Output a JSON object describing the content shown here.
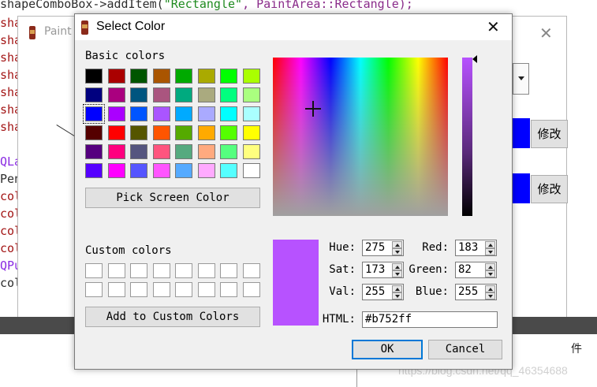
{
  "editor": {
    "top_line_prefix": "shapeComboBox->addItem(",
    "top_line_string": "\"Rectangle\"",
    "top_line_suffix": ", PaintArea::Rectangle);",
    "lines": [
      {
        "text": "sha",
        "color": "#a31515"
      },
      {
        "text": "sha",
        "color": "#a31515"
      },
      {
        "text": "sha",
        "color": "#a31515"
      },
      {
        "text": "sha",
        "color": "#a31515"
      },
      {
        "text": "sha",
        "color": "#a31515"
      },
      {
        "text": "sha",
        "color": "#a31515"
      },
      {
        "text": "sha",
        "color": "#a31515"
      },
      {
        "text": "",
        "color": "#a31515"
      },
      {
        "text": "QLa",
        "color": "#8a2be2"
      },
      {
        "text": "Pen",
        "color": "#2d2d2d"
      },
      {
        "text": "col",
        "color": "#a31515"
      },
      {
        "text": "col",
        "color": "#a31515"
      },
      {
        "text": "col",
        "color": "#a31515"
      },
      {
        "text": "col",
        "color": "#a31515"
      },
      {
        "text": "QPu",
        "color": "#8a2be2"
      },
      {
        "text": "col",
        "color": "#2d2d2d"
      }
    ],
    "side_char": "件",
    "watermark": "https://blog.csdn.net/qq_46354688"
  },
  "paint_window": {
    "title": "Paint",
    "edit_button_label_1": "修改",
    "edit_button_label_2": "修改",
    "swatch_color": "#0000ff"
  },
  "dialog": {
    "title": "Select Color",
    "basic_colors_label": "Basic colors",
    "basic_colors": [
      "#000000",
      "#aa0000",
      "#005500",
      "#aa5500",
      "#00aa00",
      "#aaaa00",
      "#00ff00",
      "#aaff00",
      "#00007f",
      "#aa007f",
      "#00557f",
      "#aa557f",
      "#00aa7f",
      "#aaaa7f",
      "#00ff7f",
      "#aaff7f",
      "#0000ff",
      "#aa00ff",
      "#0055ff",
      "#aa55ff",
      "#00aaff",
      "#aaaaff",
      "#00ffff",
      "#aaffff",
      "#550000",
      "#ff0000",
      "#555500",
      "#ff5500",
      "#55aa00",
      "#ffaa00",
      "#55ff00",
      "#ffff00",
      "#55007f",
      "#ff007f",
      "#55557f",
      "#ff557f",
      "#55aa7f",
      "#ffaa7f",
      "#55ff7f",
      "#ffff7f",
      "#5500ff",
      "#ff00ff",
      "#5555ff",
      "#ff55ff",
      "#55aaff",
      "#ffaaff",
      "#55ffff",
      "#ffffff"
    ],
    "selected_basic_index": 16,
    "pick_screen_label": "Pick Screen Color",
    "custom_colors_label": "Custom colors",
    "add_custom_label": "Add to Custom Colors",
    "preview_color": "#b752ff",
    "fields": {
      "hue_label": "Hue:",
      "hue": "275",
      "sat_label": "Sat:",
      "sat": "173",
      "val_label": "Val:",
      "val": "255",
      "red_label": "Red:",
      "red": "183",
      "green_label": "Green:",
      "green": "82",
      "blue_label": "Blue:",
      "blue": "255",
      "html_label": "HTML:",
      "html": "#b752ff"
    },
    "ok_label": "OK",
    "cancel_label": "Cancel"
  }
}
